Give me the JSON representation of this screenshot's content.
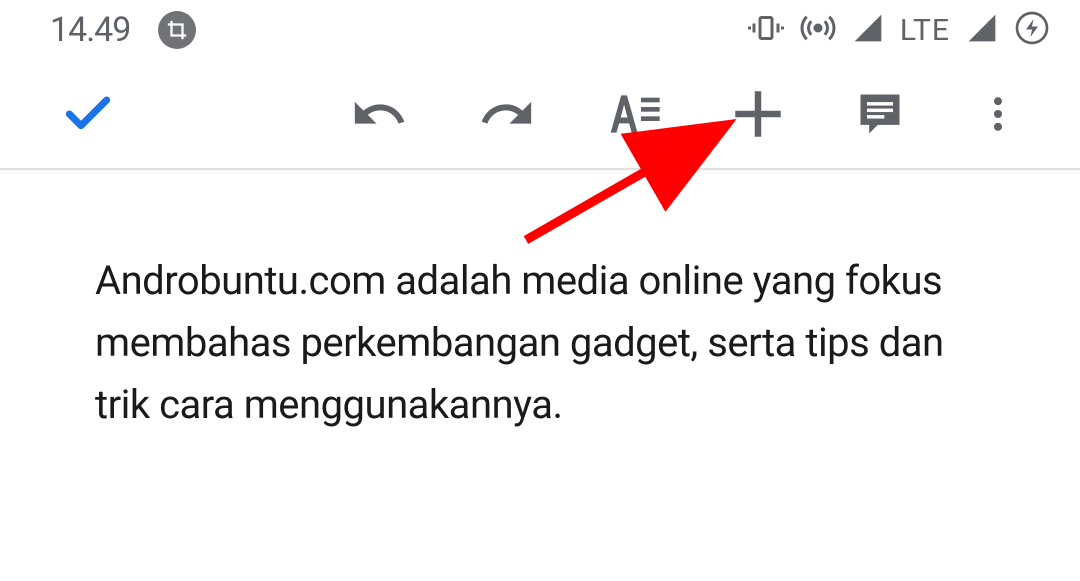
{
  "status_bar": {
    "time": "14.49",
    "network_label": "LTE"
  },
  "toolbar": {
    "confirm_icon": "check",
    "undo_icon": "undo",
    "redo_icon": "redo",
    "format_icon": "format-text",
    "insert_icon": "plus",
    "comment_icon": "comment",
    "menu_icon": "more-vertical"
  },
  "document": {
    "body_text": "Androbuntu.com adalah media online yang fokus membahas perkembangan gadget, serta tips dan trik cara menggunakannya."
  },
  "annotation": {
    "target": "insert-button",
    "color": "#ff0000"
  }
}
